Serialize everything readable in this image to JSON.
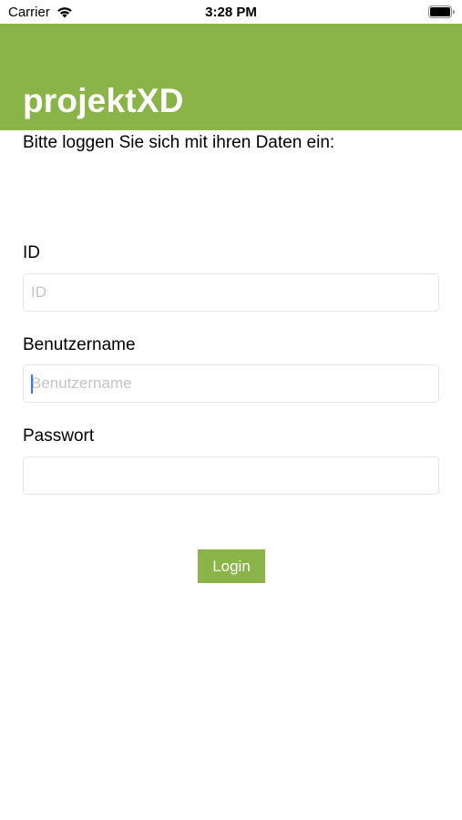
{
  "status_bar": {
    "carrier": "Carrier",
    "time": "3:28 PM",
    "wifi_icon": "wifi-icon",
    "battery_icon": "battery-icon"
  },
  "header": {
    "title": "projektXD",
    "background_color": "#8ab447"
  },
  "intro": {
    "text": "Bitte loggen Sie sich mit ihren Daten ein:"
  },
  "form": {
    "id": {
      "label": "ID",
      "placeholder": "ID",
      "value": ""
    },
    "username": {
      "label": "Benutzername",
      "placeholder": "Benutzername",
      "value": "",
      "focused": true
    },
    "password": {
      "label": "Passwort",
      "placeholder": "",
      "value": ""
    },
    "login_button": {
      "label": "Login",
      "background_color": "#8ab447"
    }
  }
}
